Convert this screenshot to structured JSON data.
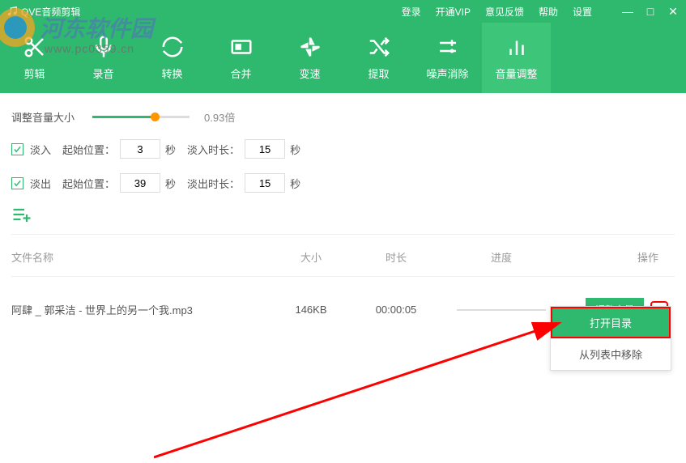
{
  "app": {
    "title": "QVE音频剪辑"
  },
  "topnav": {
    "login": "登录",
    "vip": "开通VIP",
    "feedback": "意见反馈",
    "help": "帮助",
    "settings": "设置"
  },
  "watermark": {
    "text": "河东软件园",
    "url": "www.pc0359.cn"
  },
  "nav": {
    "cut": "剪辑",
    "record": "录音",
    "convert": "转换",
    "merge": "合并",
    "speed": "变速",
    "extract": "提取",
    "denoise": "噪声消除",
    "volume": "音量调整"
  },
  "vol": {
    "label": "调整音量大小",
    "value": "0.93倍",
    "fill_pct": "62%",
    "thumb_pct": "60%"
  },
  "fadein": {
    "label": "淡入",
    "start_label": "起始位置：",
    "start_val": "3",
    "unit": "秒",
    "dur_label": "淡入时长：",
    "dur_val": "15"
  },
  "fadeout": {
    "label": "淡出",
    "start_label": "起始位置：",
    "start_val": "39",
    "unit": "秒",
    "dur_label": "淡出时长：",
    "dur_val": "15"
  },
  "table": {
    "head": {
      "name": "文件名称",
      "size": "大小",
      "duration": "时长",
      "progress": "进度",
      "action": "操作"
    },
    "rows": [
      {
        "name": "阿肆 _ 郭采洁 - 世界上的另一个我.mp3",
        "size": "146KB",
        "duration": "00:00:05",
        "action": "调整音量"
      }
    ]
  },
  "menu": {
    "open": "打开目录",
    "remove": "从列表中移除"
  }
}
